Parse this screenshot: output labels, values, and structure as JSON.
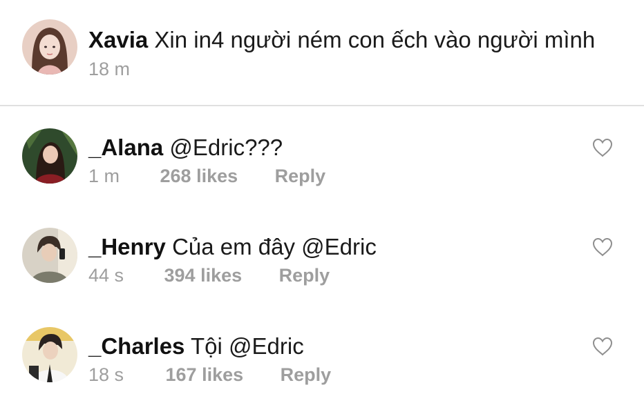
{
  "post": {
    "username": "Xavia",
    "text": "Xin in4 người ném con ếch vào người mình",
    "time": "18 m"
  },
  "comments": [
    {
      "username": "_Alana",
      "text": "@Edric???",
      "time": "1 m",
      "likes": "268 likes",
      "reply": "Reply",
      "icon": "heart-outline-icon"
    },
    {
      "username": "_Henry",
      "text": "Của em đây @Edric",
      "time": "44 s",
      "likes": "394 likes",
      "reply": "Reply",
      "icon": "heart-outline-icon"
    },
    {
      "username": "_Charles",
      "text": "Tội @Edric",
      "time": "18 s",
      "likes": "167 likes",
      "reply": "Reply",
      "icon": "heart-outline-icon"
    }
  ],
  "colors": {
    "text": "#1a1a1a",
    "secondary": "#9e9e9e",
    "divider": "#e0e0e0"
  }
}
